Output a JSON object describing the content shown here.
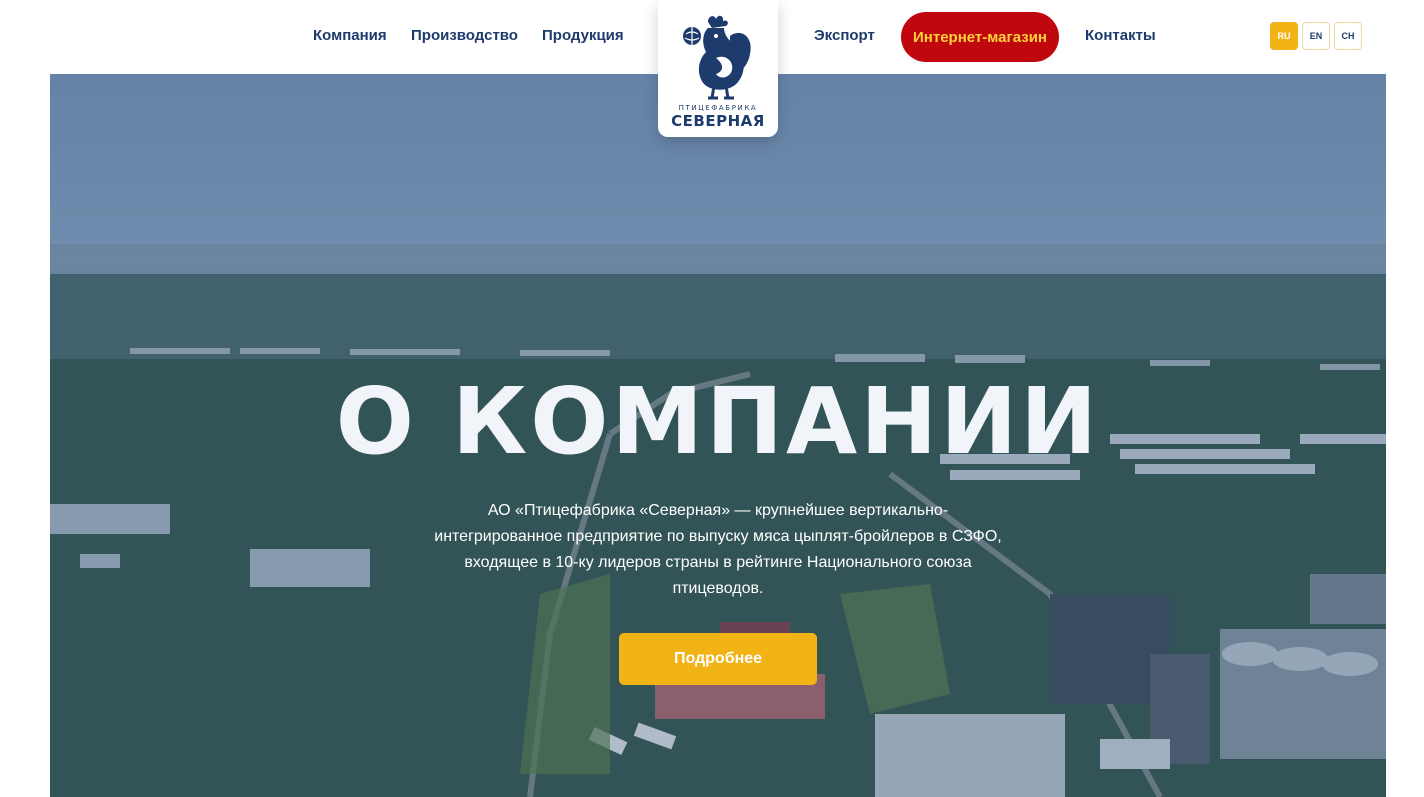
{
  "nav": {
    "items": [
      {
        "label": "Компания"
      },
      {
        "label": "Производство"
      },
      {
        "label": "Продукция"
      },
      {
        "label": "Экспорт"
      },
      {
        "label": "Интернет-магазин"
      },
      {
        "label": "Контакты"
      }
    ]
  },
  "languages": [
    {
      "code": "RU",
      "active": true
    },
    {
      "code": "EN",
      "active": false
    },
    {
      "code": "CH",
      "active": false
    }
  ],
  "logo": {
    "subtitle": "ПТИЦЕФАБРИКА",
    "name": "СЕВЕРНАЯ",
    "icon": "rooster-logo-icon"
  },
  "hero": {
    "title": "О КОМПАНИИ",
    "description": "АО «Птицефабрика «Северная» — крупнейшее вертикально-интегрированное предприятие по выпуску мяса цыплят-бройлеров в СЗФО, входящее в 10-ку лидеров страны в рейтинге Национального союза птицеводов.",
    "button_label": "Подробнее"
  },
  "colors": {
    "brand_blue": "#1d3b6c",
    "shop_red": "#c0070e",
    "shop_text": "#ffd23a",
    "accent_yellow": "#f2b316"
  }
}
